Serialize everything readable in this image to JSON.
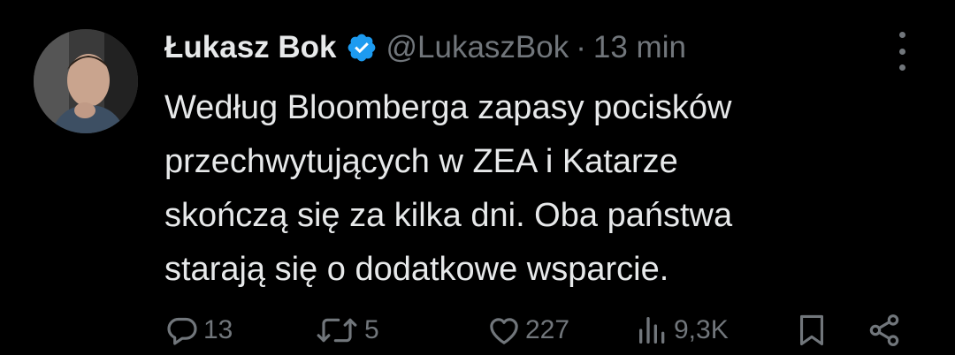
{
  "tweet": {
    "author": {
      "display_name": "Łukasz Bok",
      "handle": "@LukaszBok",
      "verified": true,
      "verified_color": "#1d9bf0"
    },
    "separator": "·",
    "time": "13 min",
    "text_lines": [
      "Według Bloomberga zapasy pocisków",
      "przechwytujących w ZEA i Katarze",
      "skończą się za kilka dni. Oba państwa",
      "starają się o dodatkowe wsparcie."
    ],
    "actions": {
      "replies": "13",
      "reposts": "5",
      "likes": "227",
      "views": "9,3K"
    }
  },
  "colors": {
    "background": "#000000",
    "primary_text": "#e7e9ea",
    "secondary_text": "#71767b"
  },
  "icons": {
    "more": "more-vertical-icon",
    "verified": "verified-badge-icon",
    "reply": "reply-icon",
    "repost": "repost-icon",
    "like": "heart-icon",
    "views": "views-chart-icon",
    "bookmark": "bookmark-icon",
    "share": "share-icon"
  }
}
